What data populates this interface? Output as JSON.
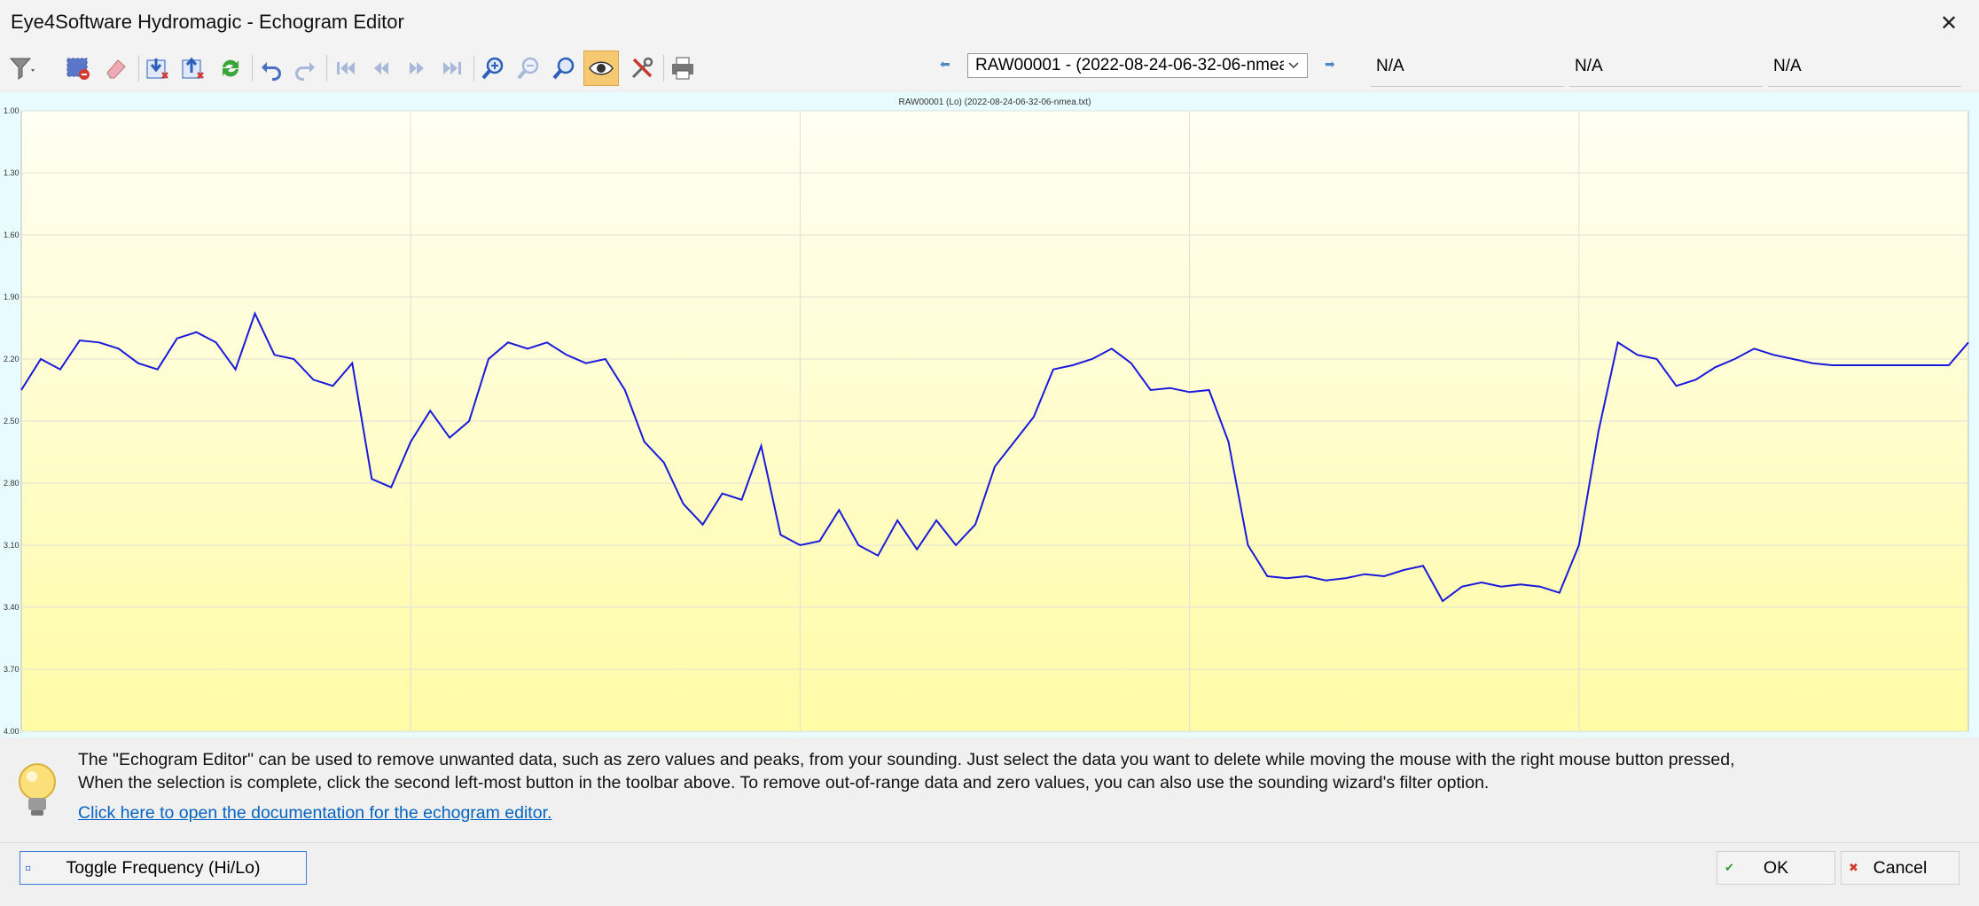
{
  "window": {
    "title": "Eye4Software Hydromagic - Echogram Editor",
    "close_glyph": "✕"
  },
  "toolbar": {
    "buttons": [
      {
        "name": "filter-icon"
      },
      {
        "name": "delete-selection-icon"
      },
      {
        "name": "eraser-icon"
      },
      {
        "name": "import-icon"
      },
      {
        "name": "export-icon"
      },
      {
        "name": "refresh-icon"
      },
      {
        "name": "undo-icon"
      },
      {
        "name": "redo-icon"
      },
      {
        "name": "first-icon"
      },
      {
        "name": "previous-icon"
      },
      {
        "name": "next-icon"
      },
      {
        "name": "last-icon"
      },
      {
        "name": "zoom-in-icon"
      },
      {
        "name": "zoom-out-icon"
      },
      {
        "name": "zoom-fit-icon"
      },
      {
        "name": "eye-icon"
      },
      {
        "name": "tools-icon"
      },
      {
        "name": "print-icon"
      }
    ],
    "file_select_value": "RAW00001 - (2022-08-24-06-32-06-nmea",
    "na_fields": [
      "N/A",
      "N/A",
      "N/A"
    ]
  },
  "chart_data": {
    "type": "line",
    "title": "RAW00001 (Lo) (2022-08-24-06-32-06-nmea.txt)",
    "ylabel": "",
    "xlabel": "",
    "ylim": [
      4.0,
      1.0
    ],
    "y_inverted": true,
    "y_ticks": [
      "1.00",
      "1.30",
      "1.60",
      "1.90",
      "2.20",
      "2.50",
      "2.80",
      "3.10",
      "3.40",
      "3.70",
      "4.00"
    ],
    "x_vertical_gridlines": 5,
    "grid": true,
    "line_color": "#1a1adb",
    "x": [
      0,
      10,
      20,
      30,
      40,
      50,
      60,
      70,
      80,
      90,
      100,
      110,
      120,
      130,
      140,
      150,
      160,
      170,
      180,
      190,
      200,
      210,
      220,
      230,
      240,
      250,
      260,
      270,
      280,
      290,
      300,
      310,
      320,
      330,
      340,
      350,
      360,
      370,
      380,
      390,
      400,
      410,
      420,
      430,
      440,
      450,
      460,
      470,
      480,
      490,
      500,
      510,
      520,
      530,
      540,
      550,
      560,
      570,
      580,
      590,
      600,
      610,
      620,
      630,
      640,
      650,
      660,
      670,
      680,
      690,
      700,
      710,
      720,
      730,
      740,
      750,
      760,
      770,
      780,
      790,
      800,
      810,
      820,
      830,
      840,
      850,
      860,
      870,
      880,
      890,
      900,
      910,
      920,
      930,
      940,
      950,
      960,
      970,
      980,
      990,
      1000
    ],
    "values": [
      2.35,
      2.2,
      2.25,
      2.11,
      2.12,
      2.15,
      2.22,
      2.25,
      2.1,
      2.07,
      2.12,
      2.25,
      1.98,
      2.18,
      2.2,
      2.3,
      2.33,
      2.22,
      2.78,
      2.82,
      2.6,
      2.45,
      2.58,
      2.5,
      2.2,
      2.12,
      2.15,
      2.12,
      2.18,
      2.22,
      2.2,
      2.35,
      2.6,
      2.7,
      2.9,
      3.0,
      2.85,
      2.88,
      2.62,
      3.05,
      3.1,
      3.08,
      2.93,
      3.1,
      3.15,
      2.98,
      3.12,
      2.98,
      3.1,
      3.0,
      2.72,
      2.6,
      2.48,
      2.25,
      2.23,
      2.2,
      2.15,
      2.22,
      2.35,
      2.34,
      2.36,
      2.35,
      2.6,
      3.1,
      3.25,
      3.26,
      3.25,
      3.27,
      3.26,
      3.24,
      3.25,
      3.22,
      3.2,
      3.37,
      3.3,
      3.28,
      3.3,
      3.29,
      3.3,
      3.33,
      3.1,
      2.55,
      2.12,
      2.18,
      2.2,
      2.33,
      2.3,
      2.24,
      2.2,
      2.15,
      2.18,
      2.2,
      2.22,
      2.23,
      2.23,
      2.23,
      2.23,
      2.23,
      2.23,
      2.23,
      2.12
    ]
  },
  "info": {
    "line1": "The \"Echogram Editor\" can be used to remove unwanted data, such as zero values and peaks, from your sounding. Just select the data you want to delete while moving the mouse with the right mouse button pressed,",
    "line2": "When the selection is complete, click the second left-most button in the toolbar above. To remove out-of-range data and zero values, you can also use the sounding wizard's filter option.",
    "link": "Click here to open the documentation for the echogram editor."
  },
  "buttons": {
    "toggle": "Toggle Frequency (Hi/Lo)",
    "ok": "OK",
    "cancel": "Cancel"
  }
}
